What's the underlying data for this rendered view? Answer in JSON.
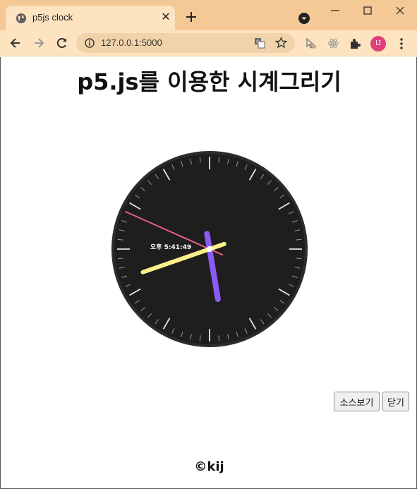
{
  "browser": {
    "tab_title": "p5js clock",
    "url": "127.0.0.1:5000",
    "profile_initials": "IJ",
    "profile_color": "#e0407a"
  },
  "page": {
    "title": "p5.js를 이용한 시계그리기",
    "footer": "©kij"
  },
  "clock": {
    "time_label": "오후 5:41:49",
    "hours": 5,
    "minutes": 41,
    "seconds": 49,
    "face_color": "#1e1e1e",
    "hour_hand_color": "#8a5cf5",
    "minute_hand_color": "#fbf08c",
    "second_hand_color": "#e8607f"
  },
  "buttons": {
    "source": "소스보기",
    "close": "닫기"
  }
}
